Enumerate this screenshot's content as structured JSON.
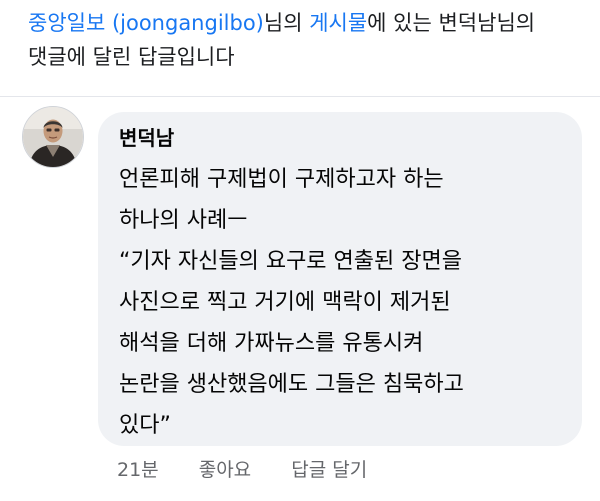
{
  "header": {
    "page_name": "중앙일보 (joongangilbo)",
    "text1": "님의 ",
    "post_link": "게시물",
    "text2": "에 있는 변덕남님의",
    "line2": "댓글에 달린 답글입니다"
  },
  "reply": {
    "author": "변덕남",
    "avatar_icon": "profile-photo",
    "lines": [
      "언론피해 구제법이 구제하고자 하는",
      "하나의 사례ㅡ",
      "“기자 자신들의 요구로 연출된 장면을",
      "사진으로 찍고 거기에 맥락이 제거된",
      "해석을 더해 가짜뉴스를 유통시켜",
      "논란을 생산했음에도 그들은 침묵하고",
      "있다”"
    ],
    "time": "21분",
    "like": "좋아요",
    "reply_action": "답글 달기"
  },
  "colors": {
    "link": "#1877f2",
    "bubble": "#f0f2f5",
    "meta": "#65676b"
  }
}
